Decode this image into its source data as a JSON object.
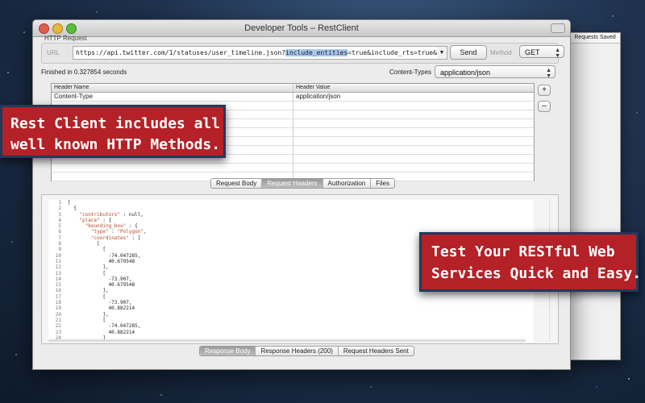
{
  "window": {
    "title": "Developer Tools – RestClient",
    "group_label": "HTTP Request"
  },
  "request": {
    "url_label": "URL",
    "url_prefix": "https://api.twitter.com/1/statuses/user_timeline.json?",
    "url_highlight": "include_entities",
    "url_suffix": "=true&include_rts=true&screen_name",
    "send_label": "Send",
    "method_label": "Method",
    "method_value": "GET"
  },
  "status": {
    "text": "Finished in 0.327854 seconds",
    "content_type_label": "Content-Types",
    "content_type_value": "application/json"
  },
  "headers_table": {
    "columns": [
      "Header Name",
      "Header Value"
    ],
    "rows": [
      {
        "name": "Content-Type",
        "value": "application/json"
      },
      {
        "name": "",
        "value": ""
      },
      {
        "name": "",
        "value": ""
      },
      {
        "name": "",
        "value": ""
      },
      {
        "name": "",
        "value": ""
      },
      {
        "name": "",
        "value": ""
      },
      {
        "name": "",
        "value": ""
      },
      {
        "name": "",
        "value": ""
      },
      {
        "name": "",
        "value": ""
      },
      {
        "name": "",
        "value": ""
      }
    ],
    "add_label": "+",
    "remove_label": "–"
  },
  "request_tabs": [
    {
      "label": "Request Body",
      "active": false
    },
    {
      "label": "Request Headers",
      "active": true
    },
    {
      "label": "Authorization",
      "active": false
    },
    {
      "label": "Files",
      "active": false
    }
  ],
  "response_tabs": [
    {
      "label": "Response Body",
      "active": true
    },
    {
      "label": "Response Headers (200)",
      "active": false
    },
    {
      "label": "Request Headers Sent",
      "active": false
    }
  ],
  "code_lines": [
    {
      "n": "1",
      "text": "[",
      "s": ""
    },
    {
      "n": "2",
      "text": "  {",
      "s": ""
    },
    {
      "n": "3",
      "text": "    ",
      "s": "\"contributors\"",
      "t": " : null,"
    },
    {
      "n": "4",
      "text": "    ",
      "s": "\"place\"",
      "t": " : {"
    },
    {
      "n": "5",
      "text": "      ",
      "s": "\"bounding_box\"",
      "t": " : {"
    },
    {
      "n": "6",
      "text": "        ",
      "s": "\"type\"",
      "t": " : ",
      "s2": "\"Polygon\"",
      "t2": ","
    },
    {
      "n": "7",
      "text": "        ",
      "s": "\"coordinates\"",
      "t": " : ["
    },
    {
      "n": "8",
      "text": "          [",
      "s": ""
    },
    {
      "n": "9",
      "text": "            [",
      "s": ""
    },
    {
      "n": "10",
      "text": "              -74.047285,",
      "s": ""
    },
    {
      "n": "11",
      "text": "              40.679548",
      "s": ""
    },
    {
      "n": "12",
      "text": "            ],",
      "s": ""
    },
    {
      "n": "13",
      "text": "            [",
      "s": ""
    },
    {
      "n": "14",
      "text": "              -73.907,",
      "s": ""
    },
    {
      "n": "15",
      "text": "              40.679548",
      "s": ""
    },
    {
      "n": "16",
      "text": "            ],",
      "s": ""
    },
    {
      "n": "17",
      "text": "            [",
      "s": ""
    },
    {
      "n": "18",
      "text": "              -73.907,",
      "s": ""
    },
    {
      "n": "19",
      "text": "              40.882214",
      "s": ""
    },
    {
      "n": "20",
      "text": "            ],",
      "s": ""
    },
    {
      "n": "21",
      "text": "            [",
      "s": ""
    },
    {
      "n": "22",
      "text": "              -74.047285,",
      "s": ""
    },
    {
      "n": "23",
      "text": "              40.882214",
      "s": ""
    },
    {
      "n": "24",
      "text": "            ]",
      "s": ""
    }
  ],
  "side_panel": {
    "title": "Requests Saved"
  },
  "callouts": {
    "left_line1": "Rest Client includes all",
    "left_line2": "well known HTTP Methods.",
    "right_line1": "Test Your RESTful Web",
    "right_line2": "Services Quick and Easy."
  },
  "colors": {
    "callout_bg": "#b42126",
    "callout_border": "#1f3a5a",
    "string_color": "#b5442d"
  }
}
